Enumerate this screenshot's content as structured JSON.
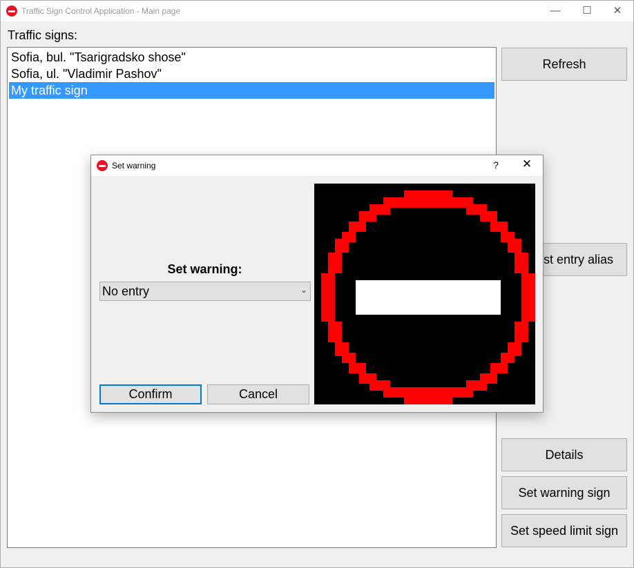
{
  "window": {
    "title": "Traffic Sign Control Application - Main page",
    "minimize_glyph": "—",
    "maximize_glyph": "☐",
    "close_glyph": "✕"
  },
  "main": {
    "list_label": "Traffic signs:",
    "items": [
      {
        "label": "Sofia, bul. \"Tsarigradsko shose\"",
        "selected": false
      },
      {
        "label": "Sofia, ul. \"Vladimir Pashov\"",
        "selected": false
      },
      {
        "label": "My traffic sign",
        "selected": true
      }
    ],
    "buttons": {
      "refresh": "Refresh",
      "set_entry_alias_visible_text": "st entry alias",
      "details": "Details",
      "set_warning_sign": "Set warning sign",
      "set_speed_limit_sign": "Set speed limit sign"
    }
  },
  "dialog": {
    "title": "Set warning",
    "help_glyph": "?",
    "close_glyph": "✕",
    "label": "Set warning:",
    "select": {
      "value": "No entry"
    },
    "confirm": "Confirm",
    "cancel": "Cancel",
    "sign_preview": {
      "sign": "no-entry",
      "ring_color": "#ff0000",
      "bar_color": "#ffffff",
      "background": "#000000"
    }
  },
  "colors": {
    "selection": "#3399ff",
    "focus_border": "#0078d7",
    "app_icon": "#e81123"
  }
}
